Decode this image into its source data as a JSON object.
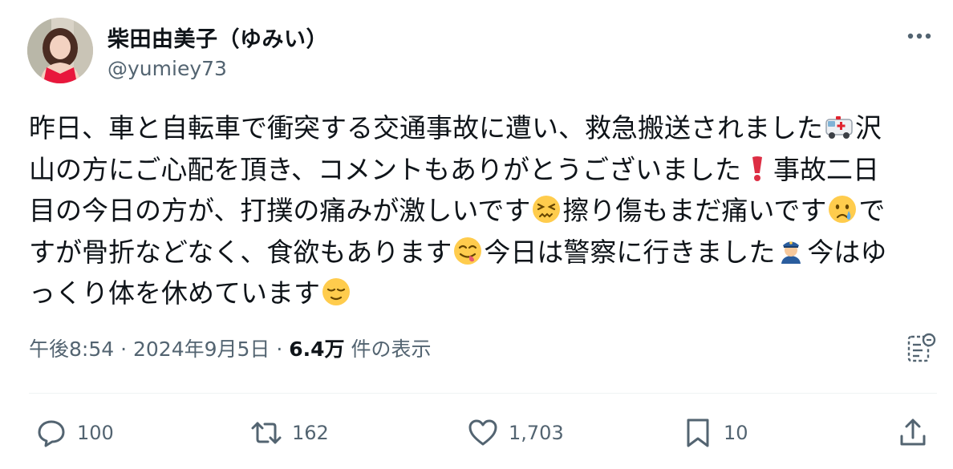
{
  "author": {
    "name": "柴田由美子（ゆみい）",
    "handle": "@yumiey73"
  },
  "tweet": {
    "line1": "昨日、車と自転車で衝突する交通事故に遭い、救急搬送されました",
    "line1b": "沢",
    "line2": "山の方にご心配を頂き、コメントもありがとうございました",
    "line2b": "事故二日",
    "line3": "目の今日の方が、打撲の痛みが激しいです",
    "line3b": "擦り傷もまだ痛いです",
    "line3c": "で",
    "line4": "すが骨折などなく、食欲もあります",
    "line4b": "今日は警察に行きました",
    "line4c": "今はゆ",
    "line5": "っくり体を休めています"
  },
  "meta": {
    "time": "午後8:54",
    "sep1": " · ",
    "date": "2024年9月5日",
    "sep2": " · ",
    "views": "6.4万",
    "views_label": " 件の表示"
  },
  "actions": {
    "replies": "100",
    "reposts": "162",
    "likes": "1,703",
    "bookmarks": "10"
  },
  "icons": {
    "emoji1": "ambulance",
    "emoji2": "heavy-exclamation-mark",
    "emoji3": "confounded-face",
    "emoji4": "crying-face",
    "emoji5": "face-savoring-food",
    "emoji6": "police-officer",
    "emoji7": "relieved-face"
  },
  "colors": {
    "text": "#0f1419",
    "secondary": "#536471",
    "divider": "#eff3f4"
  }
}
